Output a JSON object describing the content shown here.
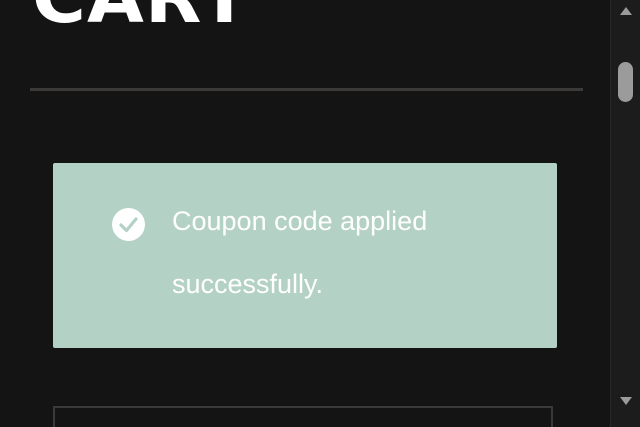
{
  "page": {
    "title": "CART"
  },
  "notice": {
    "message": "Coupon code applied successfully.",
    "icon": "check-circle-icon",
    "background_color": "#b3d1c4",
    "text_color": "#ffffff"
  },
  "scrollbar": {
    "up_icon": "chevron-up-icon",
    "down_icon": "chevron-down-icon"
  },
  "colors": {
    "background": "#151414",
    "divider": "#3b3a39",
    "thumb": "#9b9b9b"
  }
}
